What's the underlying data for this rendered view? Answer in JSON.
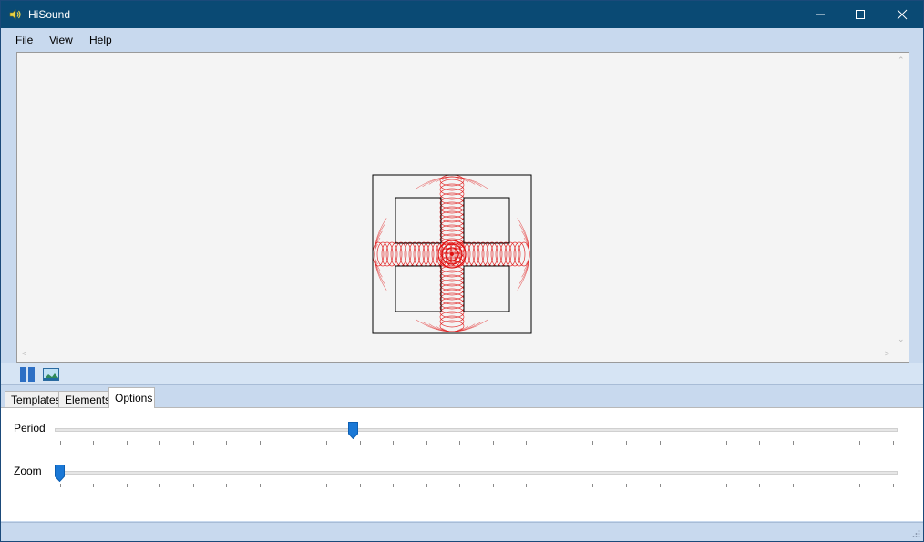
{
  "window": {
    "title": "HiSound",
    "icon": "speaker-icon",
    "controls": [
      "minimize-icon",
      "maximize-icon",
      "close-icon"
    ]
  },
  "menu": {
    "items": [
      "File",
      "View",
      "Help"
    ]
  },
  "toolbar": {
    "buttons": [
      "pause-icon",
      "image-icon"
    ]
  },
  "tabs": {
    "items": [
      "Templates",
      "Elements",
      "Options"
    ],
    "active": "Options"
  },
  "options": {
    "period": {
      "label": "Period",
      "value_fraction": 0.352
    },
    "zoom": {
      "label": "Zoom",
      "value_fraction": 0.0
    },
    "tick_count": 26
  },
  "colors": {
    "titlebar": "#0a4a74",
    "window_bg": "#c8d9ee",
    "wave": "#e01010",
    "thumb": "#1a78d6"
  }
}
